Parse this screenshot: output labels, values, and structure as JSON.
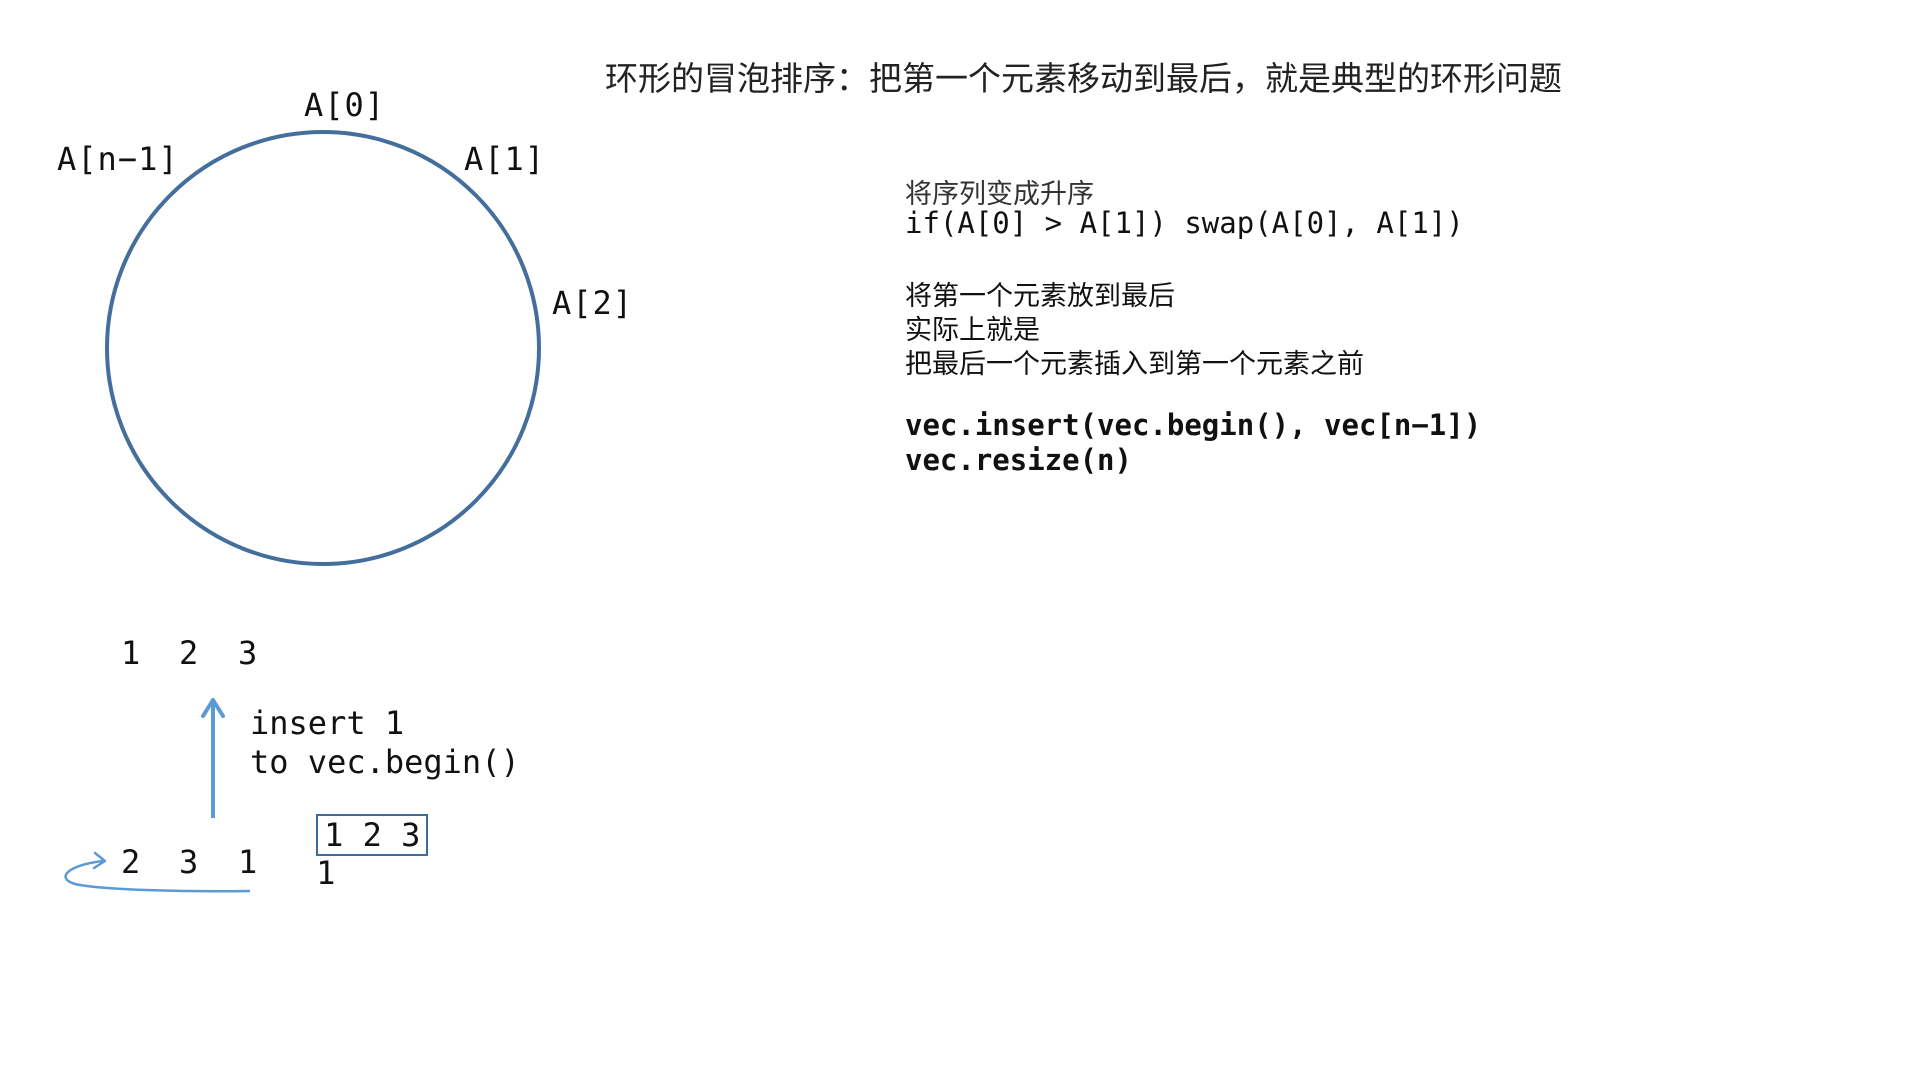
{
  "title": "环形的冒泡排序：把第一个元素移动到最后，就是典型的环形问题",
  "ring": {
    "color": "#446e9b",
    "nodes": {
      "first": "A[0]",
      "second": "A[1]",
      "third": "A[2]",
      "last": "A[n−1]"
    }
  },
  "notes": {
    "sort_heading": "将序列变成升序",
    "swap_code": "if(A[0] > A[1]) swap(A[0], A[1])",
    "move_line1": "将第一个元素放到最后",
    "move_line2": "实际上就是",
    "move_line3": "把最后一个元素插入到第一个元素之前",
    "insert_code": "vec.insert(vec.begin(), vec[n−1])",
    "resize_code": "vec.resize(n)"
  },
  "example": {
    "top_row": [
      "1",
      "2",
      "3"
    ],
    "insert_line1": "insert 1",
    "insert_line2": "to vec.begin()",
    "boxed_values": "1 2 3",
    "trailing_value": "1",
    "bottom_row": [
      "2",
      "3",
      "1"
    ],
    "arrow_color": "#5b9bd5"
  }
}
